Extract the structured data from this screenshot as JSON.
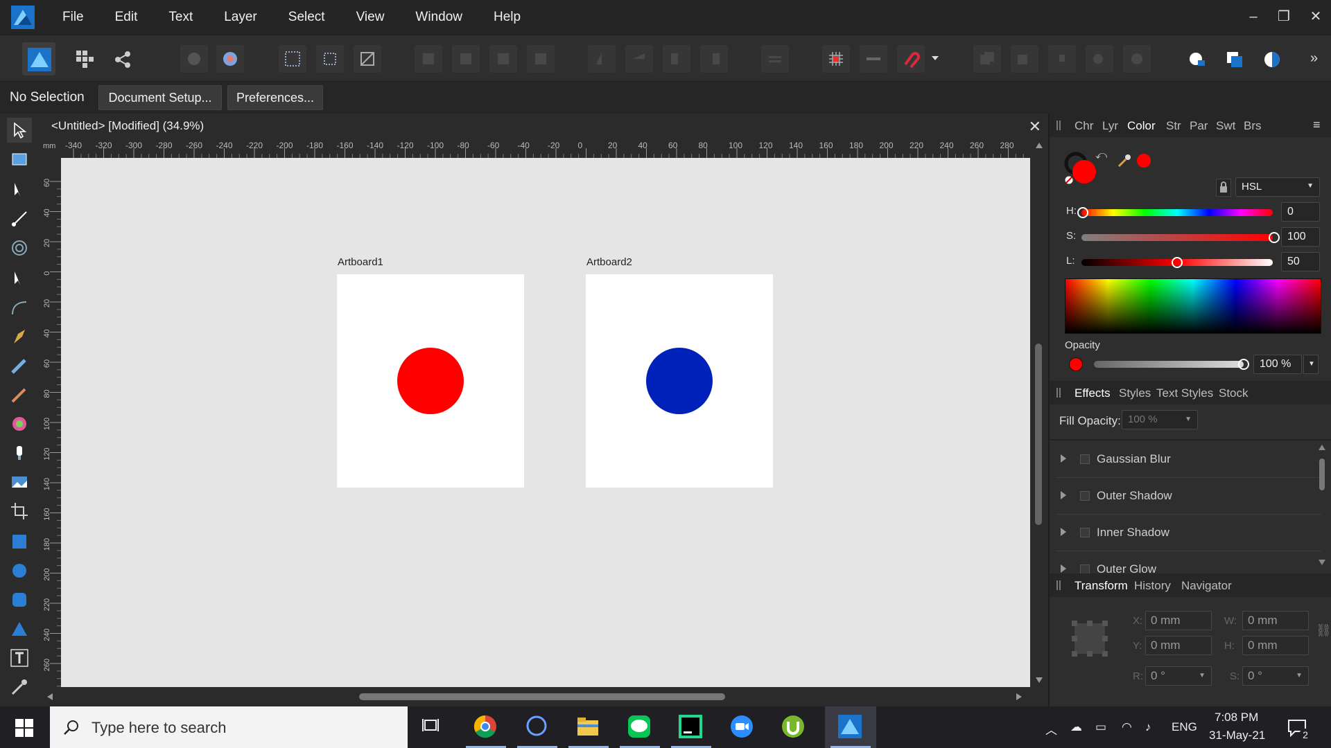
{
  "menubar": {
    "items": [
      "File",
      "Edit",
      "Text",
      "Layer",
      "Select",
      "View",
      "Window",
      "Help"
    ]
  },
  "context": {
    "status": "No Selection",
    "document_setup": "Document Setup...",
    "preferences": "Preferences..."
  },
  "document": {
    "title": "<Untitled> [Modified] (34.9%)",
    "ruler_unit": "mm",
    "ruler_top_ticks": [
      "-340",
      "-320",
      "-300",
      "-280",
      "-260",
      "-240",
      "-220",
      "-200",
      "-180",
      "-160",
      "-140",
      "-120",
      "-100",
      "-80",
      "-60",
      "-40",
      "-20",
      "0",
      "20",
      "40",
      "60",
      "80",
      "100",
      "120",
      "140",
      "160",
      "180",
      "200",
      "220",
      "240",
      "260",
      "280"
    ],
    "ruler_left_ticks": [
      "60",
      "40",
      "20",
      "0",
      "20",
      "40",
      "60",
      "80",
      "100",
      "120",
      "140",
      "160",
      "180",
      "200",
      "220",
      "240",
      "260"
    ],
    "artboards": [
      {
        "label": "Artboard1",
        "circle_color": "#ff0000"
      },
      {
        "label": "Artboard2",
        "circle_color": "#0022bb"
      }
    ]
  },
  "color_panel": {
    "tabs": [
      "Chr",
      "Lyr",
      "Color",
      "Str",
      "Par",
      "Swt",
      "Brs"
    ],
    "active_tab": "Color",
    "fill_color": "#ff0000",
    "mode": "HSL",
    "h_label": "H:",
    "h_value": "0",
    "s_label": "S:",
    "s_value": "100",
    "l_label": "L:",
    "l_value": "50",
    "opacity_label": "Opacity",
    "opacity_value": "100 %"
  },
  "effects_panel": {
    "tabs": [
      "Effects",
      "Styles",
      "Text Styles",
      "Stock"
    ],
    "fill_opacity_label": "Fill Opacity:",
    "fill_opacity_value": "100 %",
    "effects": [
      "Gaussian Blur",
      "Outer Shadow",
      "Inner Shadow",
      "Outer Glow"
    ]
  },
  "transform_panel": {
    "tabs": [
      "Transform",
      "History",
      "Navigator"
    ],
    "x_label": "X:",
    "x_value": "0 mm",
    "y_label": "Y:",
    "y_value": "0 mm",
    "w_label": "W:",
    "w_value": "0 mm",
    "h_label": "H:",
    "h_value": "0 mm",
    "r_label": "R:",
    "r_value": "0 °",
    "s_label": "S:",
    "s_value": "0 °"
  },
  "taskbar": {
    "search_placeholder": "Type here to search",
    "language": "ENG",
    "time": "7:08 PM",
    "date": "31-May-21",
    "notification_count": "2"
  }
}
